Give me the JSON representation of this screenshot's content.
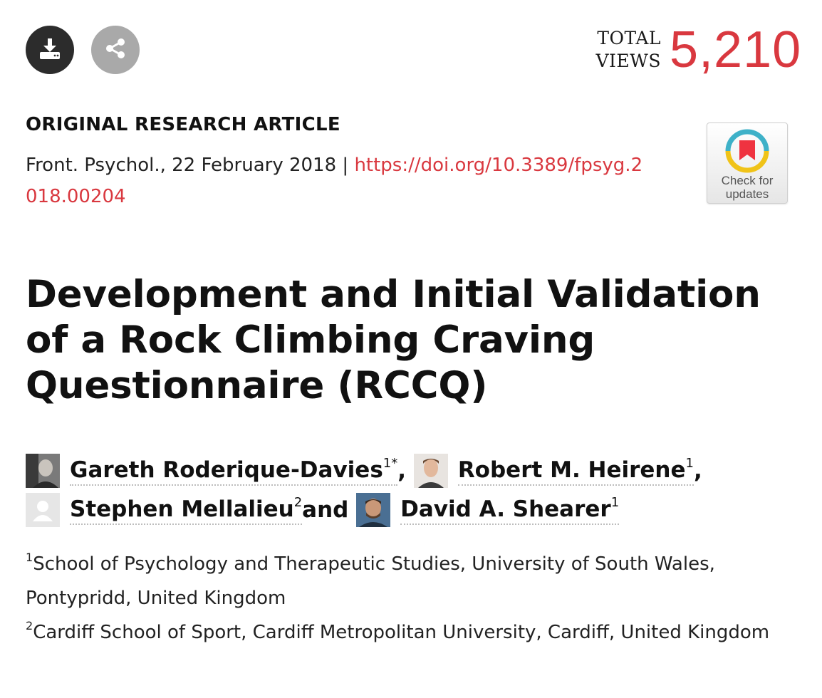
{
  "actions": {
    "download_icon": "download-icon",
    "share_icon": "share-icon"
  },
  "views": {
    "label_line1": "TOTAL",
    "label_line2": "VIEWS",
    "count": "5,210"
  },
  "article": {
    "type": "ORIGINAL RESEARCH ARTICLE",
    "citation_prefix": "Front. Psychol., 22 February 2018 | ",
    "doi": "https://doi.org/10.3389/fpsyg.2018.00204",
    "title": "Development and Initial Validation of a Rock Climbing Craving Questionnaire (RCCQ)"
  },
  "check_updates": {
    "line1": "Check for",
    "line2": "updates"
  },
  "authors": [
    {
      "name": "Gareth Roderique-Davies",
      "sup": "1*",
      "sep": ", "
    },
    {
      "name": "Robert M. Heirene",
      "sup": "1",
      "sep": ", "
    },
    {
      "name": "Stephen Mellalieu",
      "sup": "2",
      "sep": " and "
    },
    {
      "name": "David A. Shearer",
      "sup": "1",
      "sep": ""
    }
  ],
  "affiliations": [
    {
      "sup": "1",
      "text": "School of Psychology and Therapeutic Studies, University of South Wales, Pontypridd, United Kingdom"
    },
    {
      "sup": "2",
      "text": "Cardiff School of Sport, Cardiff Metropolitan University, Cardiff, United Kingdom"
    }
  ],
  "colors": {
    "accent": "#d9383f",
    "text": "#111111",
    "download_bg": "#2c2c2c",
    "share_bg": "#a9a9a9"
  }
}
